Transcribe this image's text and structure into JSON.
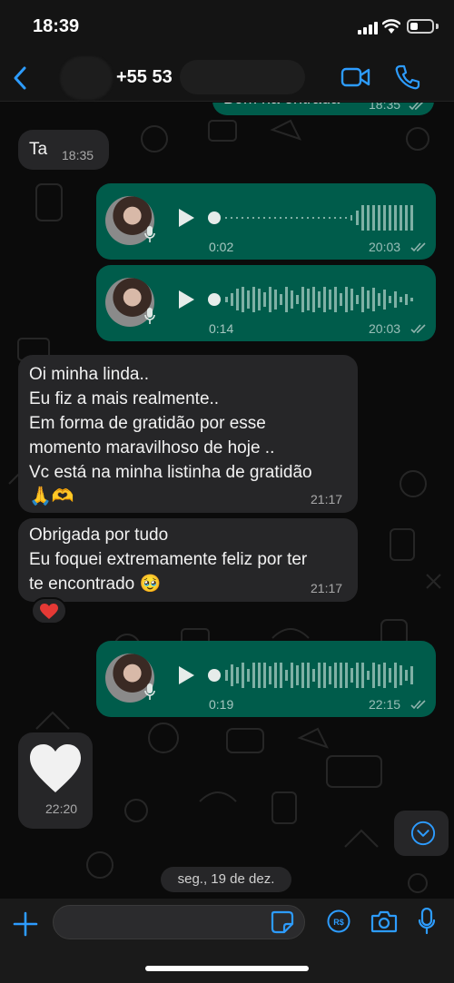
{
  "status_bar": {
    "time": "18:39"
  },
  "header": {
    "contact_name": "+55 53",
    "icons": [
      "back-icon",
      "video-call-icon",
      "phone-call-icon"
    ]
  },
  "messages": [
    {
      "type": "text",
      "direction": "outgoing",
      "text": "Bom na entrada",
      "time": "18:35"
    },
    {
      "type": "text",
      "direction": "incoming",
      "text": "Ta",
      "time": "18:35"
    },
    {
      "type": "voice",
      "direction": "outgoing",
      "duration": "0:02",
      "time": "20:03"
    },
    {
      "type": "voice",
      "direction": "outgoing",
      "duration": "0:14",
      "time": "20:03"
    },
    {
      "type": "text",
      "direction": "incoming",
      "text": "Oi minha linda..\nEu fiz a mais realmente..\nEm forma de gratidão por esse\nmomento maravilhoso de hoje ..\nVc está na minha listinha de gratidão",
      "emoji": "🙏🫶",
      "time": "21:17"
    },
    {
      "type": "text",
      "direction": "incoming",
      "text": "Obrigada por tudo\nEu foquei extremamente feliz por ter\nte encontrado 🥹",
      "time": "21:17",
      "reaction": "❤️"
    },
    {
      "type": "voice",
      "direction": "outgoing",
      "duration": "0:19",
      "time": "22:15"
    },
    {
      "type": "emoji",
      "direction": "incoming",
      "emoji": "white-heart",
      "time": "22:20"
    }
  ],
  "date_separator": "seg., 19 de dez.",
  "input_bar": {
    "placeholder": "",
    "icons": [
      "plus-icon",
      "sticker-icon",
      "payment-icon",
      "camera-icon",
      "microphone-icon"
    ]
  },
  "colors": {
    "incoming_bubble": "#262628",
    "outgoing_bubble": "#005c4b",
    "accent": "#2d9cff",
    "read_ticks": "#8fb3ad"
  }
}
